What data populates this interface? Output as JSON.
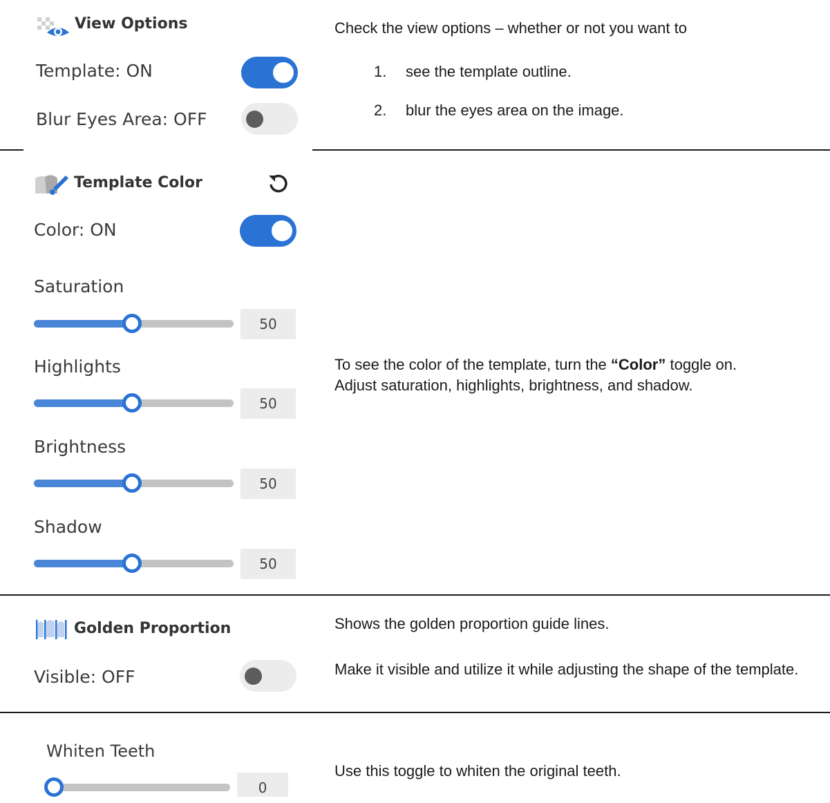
{
  "view_options": {
    "title": "View Options",
    "template_label": "Template: ON",
    "template_on": true,
    "blur_label": "Blur Eyes Area: OFF",
    "blur_on": false,
    "description": "Check the view options – whether or not you want to",
    "list": [
      {
        "num": "1.",
        "text": "see the template outline."
      },
      {
        "num": "2.",
        "text": "blur the eyes area on the image."
      }
    ]
  },
  "template_color": {
    "title": "Template Color",
    "color_label": "Color: ON",
    "color_on": true,
    "sliders": [
      {
        "label": "Saturation",
        "value": "50"
      },
      {
        "label": "Highlights",
        "value": "50"
      },
      {
        "label": "Brightness",
        "value": "50"
      },
      {
        "label": "Shadow",
        "value": "50"
      }
    ],
    "desc_pre": "To see the color of the template, turn the ",
    "desc_bold": "“Color”",
    "desc_post": " toggle on.",
    "desc_line2": "Adjust saturation, highlights, brightness, and shadow."
  },
  "golden_proportion": {
    "title": "Golden Proportion",
    "visible_label": "Visible: OFF",
    "visible_on": false,
    "desc1": "Shows the golden proportion guide lines.",
    "desc2": "Make it visible and utilize it while adjusting the shape of the template."
  },
  "whiten": {
    "label": "Whiten Teeth",
    "value": "0",
    "desc": "Use this toggle to whiten the original teeth."
  },
  "colors": {
    "accent": "#2a72d4",
    "track": "#c3c3c3",
    "knob_off": "#5d5d5d"
  }
}
